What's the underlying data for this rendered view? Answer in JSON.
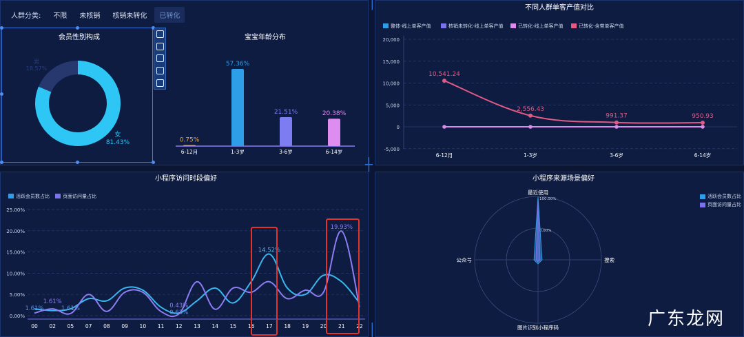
{
  "filter_bar": {
    "label": "人群分类:",
    "options": [
      "不限",
      "未核销",
      "核销未转化",
      "已转化"
    ],
    "active_index": 3
  },
  "colors": {
    "accent_blue": "#2ec6f5",
    "pink": "#e05a86",
    "purple": "#8c7df2",
    "violet": "#d98ce8",
    "highlight_red": "#e0342c"
  },
  "toolbox": {
    "icons": [
      "restore-icon",
      "pencil-icon",
      "undo-icon",
      "data-view-icon",
      "save-image-icon"
    ]
  },
  "logo_text": "广东龙网",
  "chart_data": [
    {
      "type": "pie",
      "title": "会员性别构成",
      "slices": [
        {
          "label": "女",
          "value": 81.43,
          "value_label": "81.43%"
        },
        {
          "label": "男",
          "value": 18.57,
          "value_label": "18.57%"
        }
      ]
    },
    {
      "type": "bar",
      "title": "宝宝年龄分布",
      "categories": [
        "6-12月",
        "1-3岁",
        "3-6岁",
        "6-14岁"
      ],
      "values": [
        0.75,
        57.36,
        21.51,
        20.38
      ],
      "value_labels": [
        "0.75%",
        "57.36%",
        "21.51%",
        "20.38%"
      ]
    },
    {
      "type": "line",
      "title": "不同人群单客产值对比",
      "legend": [
        "整体-线上单客产值",
        "核销未转化-线上单客产值",
        "已转化-线上单客产值",
        "已转化-含带单客产值"
      ],
      "categories": [
        "6-12月",
        "1-3岁",
        "3-6岁",
        "6-14岁"
      ],
      "series": [
        {
          "name": "已转化-含带单客产值",
          "values": [
            10541.24,
            2556.43,
            991.37,
            950.93
          ],
          "value_labels": [
            "10,541.24",
            "2,556.43",
            "991.37",
            "950.93"
          ]
        },
        {
          "name": "已转化-线上单客产值",
          "values": [
            0,
            0,
            0,
            0
          ]
        }
      ],
      "y_ticks": [
        "20,000",
        "15,000",
        "10,000",
        "5,000",
        "0",
        "-5,000"
      ],
      "ylim": [
        -5000,
        20000
      ]
    },
    {
      "type": "line",
      "title": "小程序访问时段偏好",
      "legend": [
        "活跃会员数占比",
        "页面访问量占比"
      ],
      "categories": [
        "00",
        "02",
        "05",
        "07",
        "08",
        "09",
        "10",
        "11",
        "12",
        "13",
        "14",
        "15",
        "16",
        "17",
        "18",
        "19",
        "20",
        "21",
        "22"
      ],
      "series": [
        {
          "name": "活跃会员数占比",
          "values": [
            1.61,
            1.2,
            1.61,
            4.0,
            3.5,
            6.5,
            6.0,
            2.0,
            0.63,
            3.5,
            6.5,
            3.0,
            8.0,
            14.52,
            6.5,
            5.0,
            9.5,
            8.0,
            3.0
          ]
        },
        {
          "name": "页面访问量占比",
          "values": [
            0.6,
            1.61,
            0.5,
            5.0,
            1.0,
            5.5,
            5.5,
            1.0,
            0.43,
            8.0,
            1.5,
            6.5,
            5.5,
            8.0,
            4.0,
            6.0,
            5.5,
            19.93,
            2.0
          ]
        }
      ],
      "visible_labels": [
        {
          "index": 0,
          "text": "1.61%"
        },
        {
          "index": 1,
          "text": "1.61%"
        },
        {
          "index": 2,
          "text": "1.61%"
        },
        {
          "index": 8,
          "text": "0.43%"
        },
        {
          "index": 8,
          "text": "0.63%"
        },
        {
          "index": 13,
          "text": "14.52%"
        },
        {
          "index": 17,
          "text": "19.93%"
        }
      ],
      "y_ticks": [
        "25.00%",
        "20.00%",
        "15.00%",
        "10.00%",
        "5.00%",
        "0.00%"
      ],
      "ylim": [
        0,
        25
      ]
    },
    {
      "type": "radar",
      "title": "小程序来源场景偏好",
      "legend": [
        "活跃会员数占比",
        "页面访问量占比"
      ],
      "indicators": [
        "最近使用",
        "搜索",
        "图片识别小程序码",
        "公众号"
      ],
      "ring_labels": [
        "100.00%",
        "0.00%"
      ],
      "series": [
        {
          "name": "活跃会员数占比",
          "values": [
            95,
            2,
            2,
            2
          ]
        },
        {
          "name": "页面访问量占比",
          "values": [
            90,
            1,
            1,
            1
          ]
        }
      ]
    }
  ]
}
